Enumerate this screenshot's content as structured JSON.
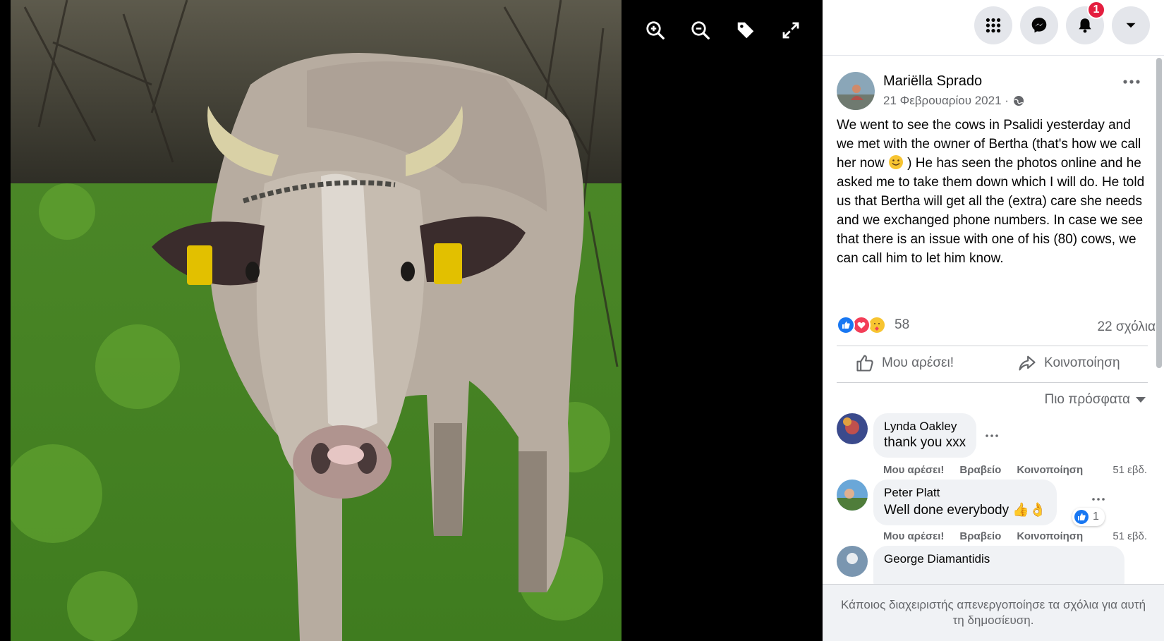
{
  "viewer": {
    "tools": [
      "zoom-in-icon",
      "zoom-out-icon",
      "tag-icon",
      "fullscreen-icon"
    ],
    "photo_subject": "cow"
  },
  "topbar": {
    "notifications_count": "1",
    "icons": [
      "menu-grid-icon",
      "messenger-icon",
      "bell-icon",
      "account-caret-icon"
    ]
  },
  "post": {
    "author": "Mariëlla Sprado",
    "date": "21 Φεβρουαρίου 2021 ·",
    "text_before_emoji": "We went to see the cows in Psalidi yesterday and we met with the owner of Bertha (that's how we call her now ",
    "text_after_emoji": " ) He has seen the photos online and he asked me to take them down which I will do. He told us that Bertha will get all the (extra) care she needs and we exchanged phone numbers. In case we see that there is an issue with one of his (80) cows, we can call him to let him know.",
    "reaction_count": "58",
    "comment_count": "22 σχόλια",
    "like_label": "Μου αρέσει!",
    "share_label": "Κοινοποίηση",
    "sort_label": "Πιο πρόσφατα"
  },
  "comments": [
    {
      "name": "Lynda Oakley",
      "text": "thank you xxx",
      "like": "Μου αρέσει!",
      "reply": "Βραβείο",
      "share": "Κοινοποίηση",
      "time": "51 εβδ."
    },
    {
      "name": "Peter Platt",
      "text": "Well done everybody 👍👌",
      "reactions": "1",
      "like": "Μου αρέσει!",
      "reply": "Βραβείο",
      "share": "Κοινοποίηση",
      "time": "51 εβδ."
    },
    {
      "name": "George Diamantidis"
    }
  ],
  "footer": {
    "note": "Κάποιος διαχειριστής απενεργοποίησε τα σχόλια για αυτή τη δημοσίευση."
  },
  "colors": {
    "accent": "#1877f2",
    "badge": "#e41e3f",
    "secondary_text": "#65676b",
    "bubble": "#f0f2f5"
  }
}
